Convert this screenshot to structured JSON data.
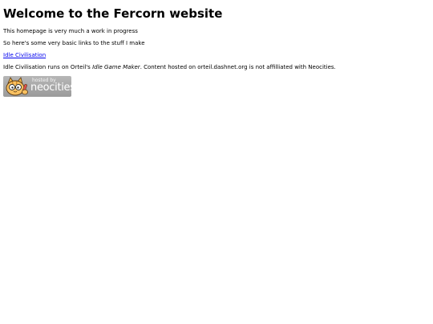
{
  "page": {
    "heading": "Welcome to the Fercorn website",
    "intro": "This homepage is very much a work in progress",
    "links_intro": "So here's some very basic links to the stuff I make",
    "links": [
      {
        "label": "Idle Civilisation"
      }
    ],
    "credits": {
      "before": "Idle Civilisation runs on Orteil's ",
      "italic": "Idle Game Maker",
      "after": ". Content hosted on orteil.dashnet.org is not affilliated with Neocities."
    }
  },
  "badge": {
    "small_text": "hosted by",
    "brand_text": "neocities",
    "icon": "neocities-cat-icon"
  }
}
